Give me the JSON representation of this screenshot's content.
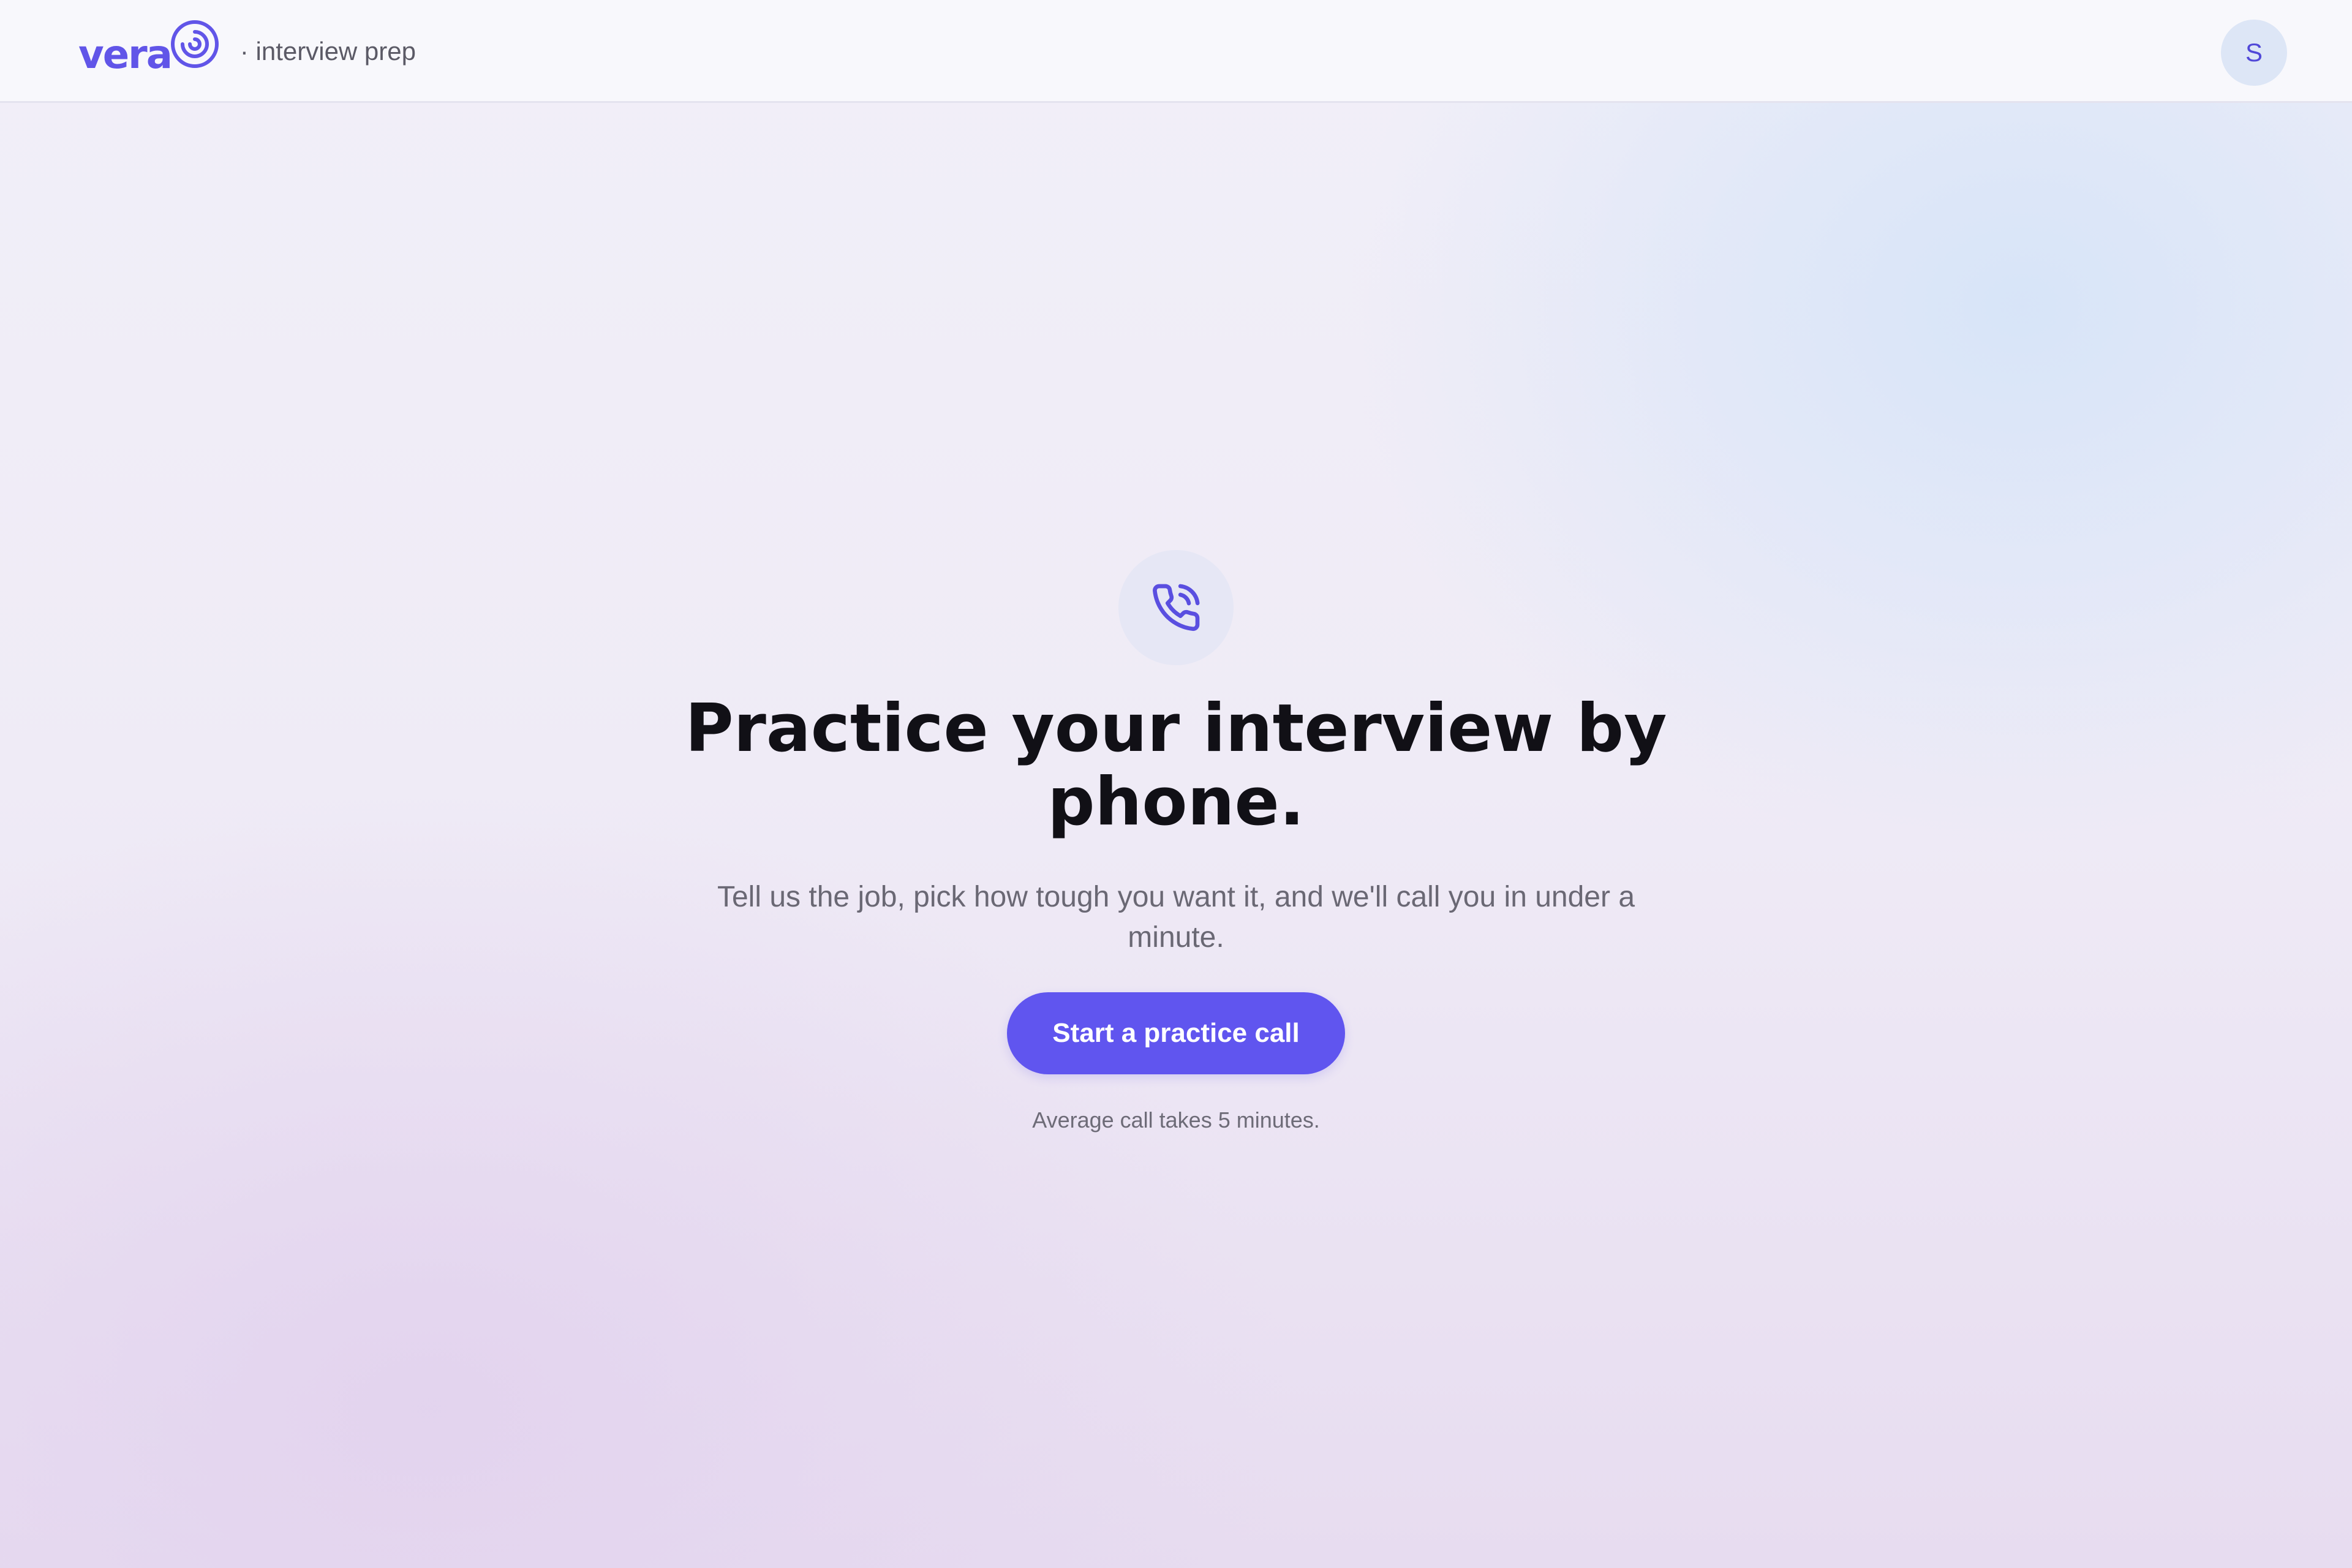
{
  "header": {
    "brand_name": "vera",
    "brand_suffix": "· interview prep",
    "avatar_initial": "S"
  },
  "hero": {
    "icon": "phone-call-icon",
    "title": "Practice your interview by phone.",
    "subtitle": "Tell us the job, pick how tough you want it, and we'll call you in under a minute.",
    "cta_label": "Start a practice call",
    "note": "Average call takes 5 minutes."
  },
  "colors": {
    "accent": "#6055ef",
    "brand": "#6155e8",
    "title": "#111016",
    "muted": "#6a6874",
    "avatar_bg": "#dde6f6"
  }
}
